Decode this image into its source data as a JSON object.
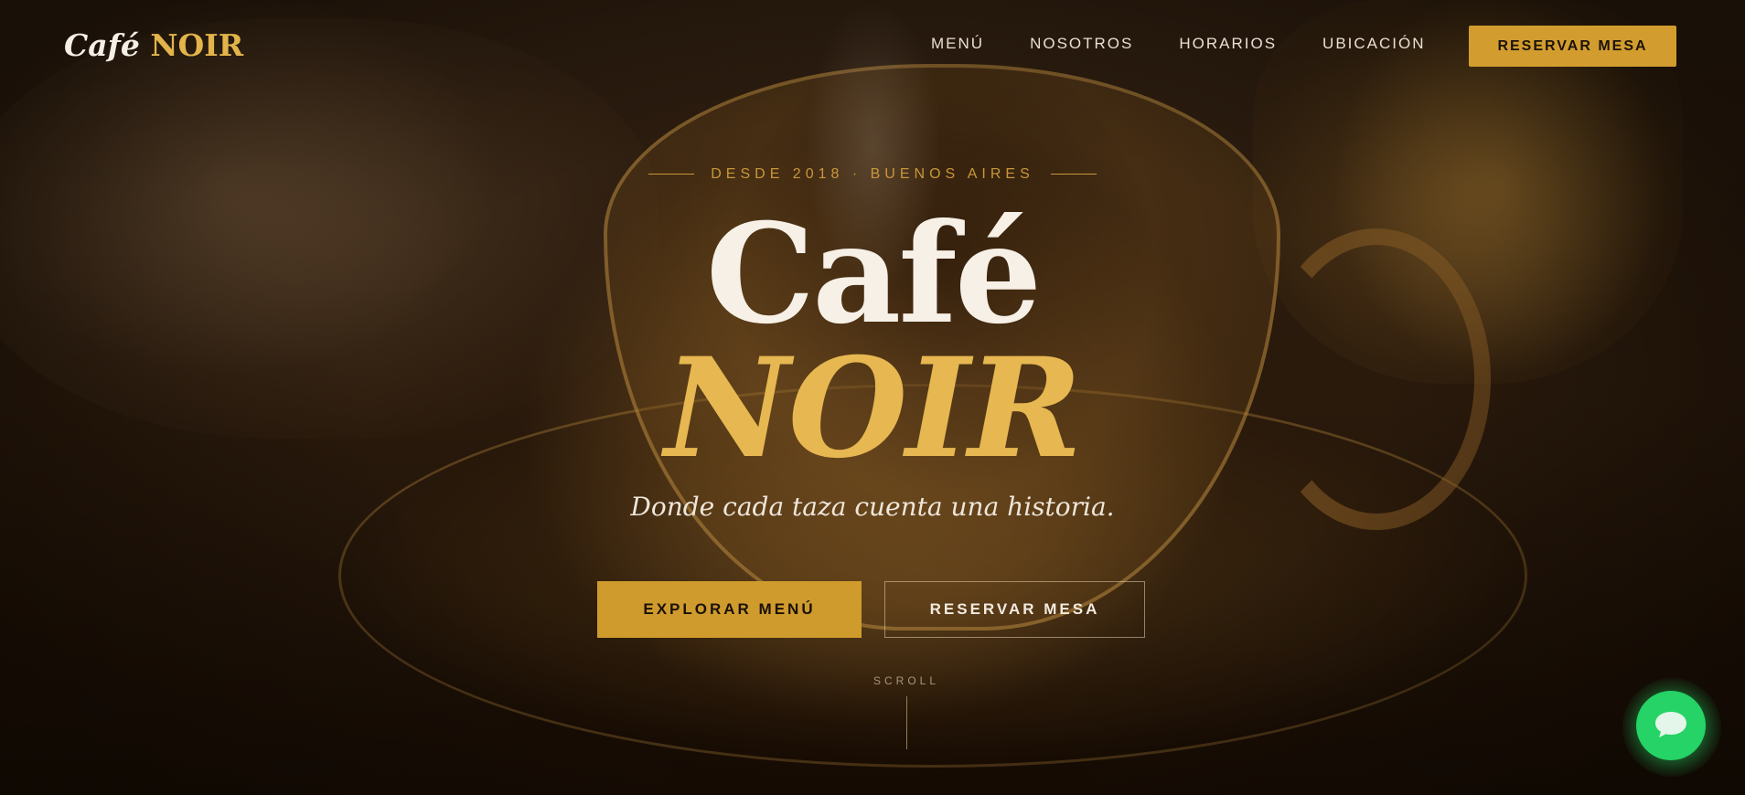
{
  "nav": {
    "logo_part1": "Café",
    "logo_part2": "NOIR",
    "links": [
      "MENÚ",
      "NOSOTROS",
      "HORARIOS",
      "UBICACIÓN"
    ],
    "cta_label": "RESERVAR MESA"
  },
  "hero": {
    "eyebrow": "DESDE 2018 · BUENOS AIRES",
    "title_line1": "Café",
    "title_line2": "NOIR",
    "tagline": "Donde cada taza cuenta una historia.",
    "primary_button": "EXPLORAR MENÚ",
    "secondary_button": "RESERVAR MESA",
    "scroll_label": "SCROLL"
  },
  "chat": {
    "icon": "chat-bubble-icon"
  },
  "colors": {
    "accent_gold": "#d29d2e",
    "title_gold": "#e7b751",
    "chat_green": "#25d366"
  }
}
